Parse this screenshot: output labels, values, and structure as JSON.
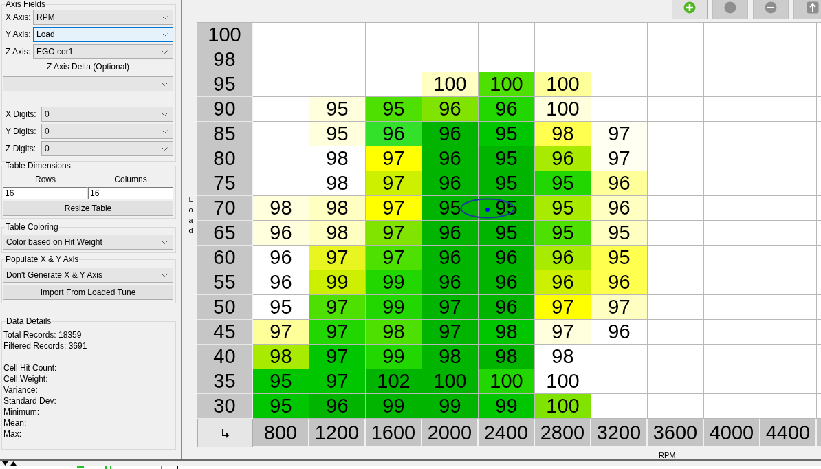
{
  "axis_fields": {
    "title": "Axis Fields",
    "selects": [
      {
        "label": "X Axis:",
        "value": "RPM",
        "focused": false
      },
      {
        "label": "Y Axis:",
        "value": "Load",
        "focused": true
      },
      {
        "label": "Z Axis:",
        "value": "EGO cor1",
        "focused": false
      }
    ],
    "delta_label": "Z Axis Delta (Optional)",
    "digits": [
      {
        "label": "X Digits:",
        "value": "0"
      },
      {
        "label": "Y Digits:",
        "value": "0"
      },
      {
        "label": "Z Digits:",
        "value": "0"
      }
    ]
  },
  "table_dimensions": {
    "title": "Table Dimensions",
    "rows_label": "Rows",
    "columns_label": "Columns",
    "rows_value": "16",
    "columns_value": "16",
    "button": "Resize Table"
  },
  "table_coloring": {
    "title": "Table Coloring",
    "value": "Color based on Hit Weight"
  },
  "populate_axis": {
    "title": "Populate X & Y Axis",
    "value": "Don't Generate X & Y Axis",
    "button": "Import From Loaded Tune"
  },
  "data_details": {
    "title": "Data Details",
    "record_counts": [
      "Total Records: 18359",
      "Filtered Records: 3691"
    ],
    "cell_stats": [
      "Cell Hit Count:",
      "Cell Weight:",
      "Variance:",
      "Standard Dev:",
      "Minimum:",
      "Mean:",
      "Max:"
    ]
  },
  "toolbar": {
    "buttons": [
      {
        "disabled": false
      },
      {
        "disabled": true
      },
      {
        "disabled": true
      },
      {
        "disabled": true
      }
    ]
  },
  "table": {
    "y_axis_label": "Load",
    "x_axis_label": "RPM",
    "columns": [
      "800",
      "1200",
      "1600",
      "2000",
      "2400",
      "2800",
      "3200",
      "3600",
      "4000",
      "4400"
    ],
    "rows": [
      {
        "label": "100"
      },
      {
        "label": "98"
      },
      {
        "label": "95",
        "cells": [
          null,
          null,
          null,
          {
            "value": "100",
            "color": "#ffffc2",
            "cursor": false
          },
          {
            "value": "100",
            "color": "#4ee000",
            "cursor": false
          },
          {
            "value": "100",
            "color": "#ffff99",
            "cursor": false
          }
        ]
      },
      {
        "label": "90",
        "cells": [
          null,
          {
            "value": "95",
            "color": "#ffffde",
            "cursor": false
          },
          {
            "value": "95",
            "color": "#4ee000",
            "cursor": false
          },
          {
            "value": "96",
            "color": "#80e400",
            "cursor": false
          },
          {
            "value": "96",
            "color": "#22d600",
            "cursor": false
          },
          {
            "value": "100",
            "color": "#ffffde",
            "cursor": false
          }
        ]
      },
      {
        "label": "85",
        "cells": [
          null,
          {
            "value": "95",
            "color": "#ffffde",
            "cursor": false
          },
          {
            "value": "96",
            "color": "#33e02a",
            "cursor": false
          },
          {
            "value": "96",
            "color": "#00b400",
            "cursor": false
          },
          {
            "value": "95",
            "color": "#00c600",
            "cursor": false
          },
          {
            "value": "98",
            "color": "#ffff50",
            "cursor": false
          },
          {
            "value": "97",
            "color": "#fffff2",
            "cursor": false
          }
        ]
      },
      {
        "label": "80",
        "cells": [
          null,
          {
            "value": "98",
            "color": "#ffffff",
            "cursor": false
          },
          {
            "value": "97",
            "color": "#ffff00",
            "cursor": false
          },
          {
            "value": "96",
            "color": "#00b400",
            "cursor": false
          },
          {
            "value": "95",
            "color": "#00b400",
            "cursor": false
          },
          {
            "value": "96",
            "color": "#a8ea00",
            "cursor": false
          },
          {
            "value": "97",
            "color": "#fffff2",
            "cursor": false
          }
        ]
      },
      {
        "label": "75",
        "cells": [
          null,
          {
            "value": "98",
            "color": "#ffffff",
            "cursor": false
          },
          {
            "value": "97",
            "color": "#ccf000",
            "cursor": false
          },
          {
            "value": "96",
            "color": "#00b400",
            "cursor": false
          },
          {
            "value": "95",
            "color": "#00b400",
            "cursor": false
          },
          {
            "value": "95",
            "color": "#22d600",
            "cursor": false
          },
          {
            "value": "96",
            "color": "#ffff99",
            "cursor": false
          }
        ]
      },
      {
        "label": "70",
        "cells": [
          {
            "value": "98",
            "color": "#ffffde",
            "cursor": false
          },
          {
            "value": "98",
            "color": "#ffffc2",
            "cursor": false
          },
          {
            "value": "97",
            "color": "#ffff00",
            "cursor": false
          },
          {
            "value": "95",
            "color": "#00b400",
            "cursor": false
          },
          {
            "value": "95",
            "color": "#00b400",
            "cursor": true
          },
          {
            "value": "95",
            "color": "#a8ea00",
            "cursor": false
          },
          {
            "value": "96",
            "color": "#ffffc2",
            "cursor": false
          }
        ]
      },
      {
        "label": "65",
        "cells": [
          {
            "value": "96",
            "color": "#ffffde",
            "cursor": false
          },
          {
            "value": "98",
            "color": "#ffffc2",
            "cursor": false
          },
          {
            "value": "97",
            "color": "#80e400",
            "cursor": false
          },
          {
            "value": "96",
            "color": "#00b400",
            "cursor": false
          },
          {
            "value": "95",
            "color": "#00b400",
            "cursor": false
          },
          {
            "value": "95",
            "color": "#4ee000",
            "cursor": false
          },
          {
            "value": "95",
            "color": "#ffffc2",
            "cursor": false
          }
        ]
      },
      {
        "label": "60",
        "cells": [
          {
            "value": "96",
            "color": "#ffffff",
            "cursor": false
          },
          {
            "value": "97",
            "color": "#e8f520",
            "cursor": false
          },
          {
            "value": "97",
            "color": "#4ee000",
            "cursor": false
          },
          {
            "value": "96",
            "color": "#00b400",
            "cursor": false
          },
          {
            "value": "96",
            "color": "#00b400",
            "cursor": false
          },
          {
            "value": "96",
            "color": "#a8ea00",
            "cursor": false
          },
          {
            "value": "95",
            "color": "#ffff50",
            "cursor": false
          }
        ]
      },
      {
        "label": "55",
        "cells": [
          {
            "value": "96",
            "color": "#ffffff",
            "cursor": false
          },
          {
            "value": "99",
            "color": "#ccf000",
            "cursor": false
          },
          {
            "value": "99",
            "color": "#22d600",
            "cursor": false
          },
          {
            "value": "96",
            "color": "#00b400",
            "cursor": false
          },
          {
            "value": "96",
            "color": "#00b400",
            "cursor": false
          },
          {
            "value": "96",
            "color": "#ccf000",
            "cursor": false
          },
          {
            "value": "96",
            "color": "#ffff50",
            "cursor": false
          }
        ]
      },
      {
        "label": "50",
        "cells": [
          {
            "value": "95",
            "color": "#ffffff",
            "cursor": false
          },
          {
            "value": "97",
            "color": "#4ee000",
            "cursor": false
          },
          {
            "value": "99",
            "color": "#22d600",
            "cursor": false
          },
          {
            "value": "97",
            "color": "#00b400",
            "cursor": false
          },
          {
            "value": "96",
            "color": "#00b400",
            "cursor": false
          },
          {
            "value": "97",
            "color": "#ffff00",
            "cursor": false
          },
          {
            "value": "97",
            "color": "#ffffc2",
            "cursor": false
          }
        ]
      },
      {
        "label": "45",
        "cells": [
          {
            "value": "97",
            "color": "#ffff99",
            "cursor": false
          },
          {
            "value": "97",
            "color": "#22d600",
            "cursor": false
          },
          {
            "value": "98",
            "color": "#4ee000",
            "cursor": false
          },
          {
            "value": "97",
            "color": "#00b400",
            "cursor": false
          },
          {
            "value": "98",
            "color": "#00c600",
            "cursor": false
          },
          {
            "value": "97",
            "color": "#ffffde",
            "cursor": false
          },
          {
            "value": "96",
            "color": "#ffffff",
            "cursor": false
          }
        ]
      },
      {
        "label": "40",
        "cells": [
          {
            "value": "98",
            "color": "#a8ea00",
            "cursor": false
          },
          {
            "value": "97",
            "color": "#00c600",
            "cursor": false
          },
          {
            "value": "99",
            "color": "#22d600",
            "cursor": false
          },
          {
            "value": "98",
            "color": "#00b400",
            "cursor": false
          },
          {
            "value": "98",
            "color": "#00b400",
            "cursor": false
          },
          {
            "value": "98",
            "color": "#ffffff",
            "cursor": false
          }
        ]
      },
      {
        "label": "35",
        "cells": [
          {
            "value": "95",
            "color": "#00c600",
            "cursor": false
          },
          {
            "value": "97",
            "color": "#00c600",
            "cursor": false
          },
          {
            "value": "102",
            "color": "#00b400",
            "cursor": false
          },
          {
            "value": "100",
            "color": "#00b400",
            "cursor": false
          },
          {
            "value": "100",
            "color": "#22d600",
            "cursor": false
          },
          {
            "value": "100",
            "color": "#ffffff",
            "cursor": false
          }
        ]
      },
      {
        "label": "30",
        "cells": [
          {
            "value": "95",
            "color": "#00c600",
            "cursor": false
          },
          {
            "value": "96",
            "color": "#00b400",
            "cursor": false
          },
          {
            "value": "99",
            "color": "#00b400",
            "cursor": false
          },
          {
            "value": "99",
            "color": "#00b400",
            "cursor": false
          },
          {
            "value": "99",
            "color": "#00c600",
            "cursor": false
          },
          {
            "value": "100",
            "color": "#80e400",
            "cursor": false
          }
        ]
      }
    ]
  }
}
